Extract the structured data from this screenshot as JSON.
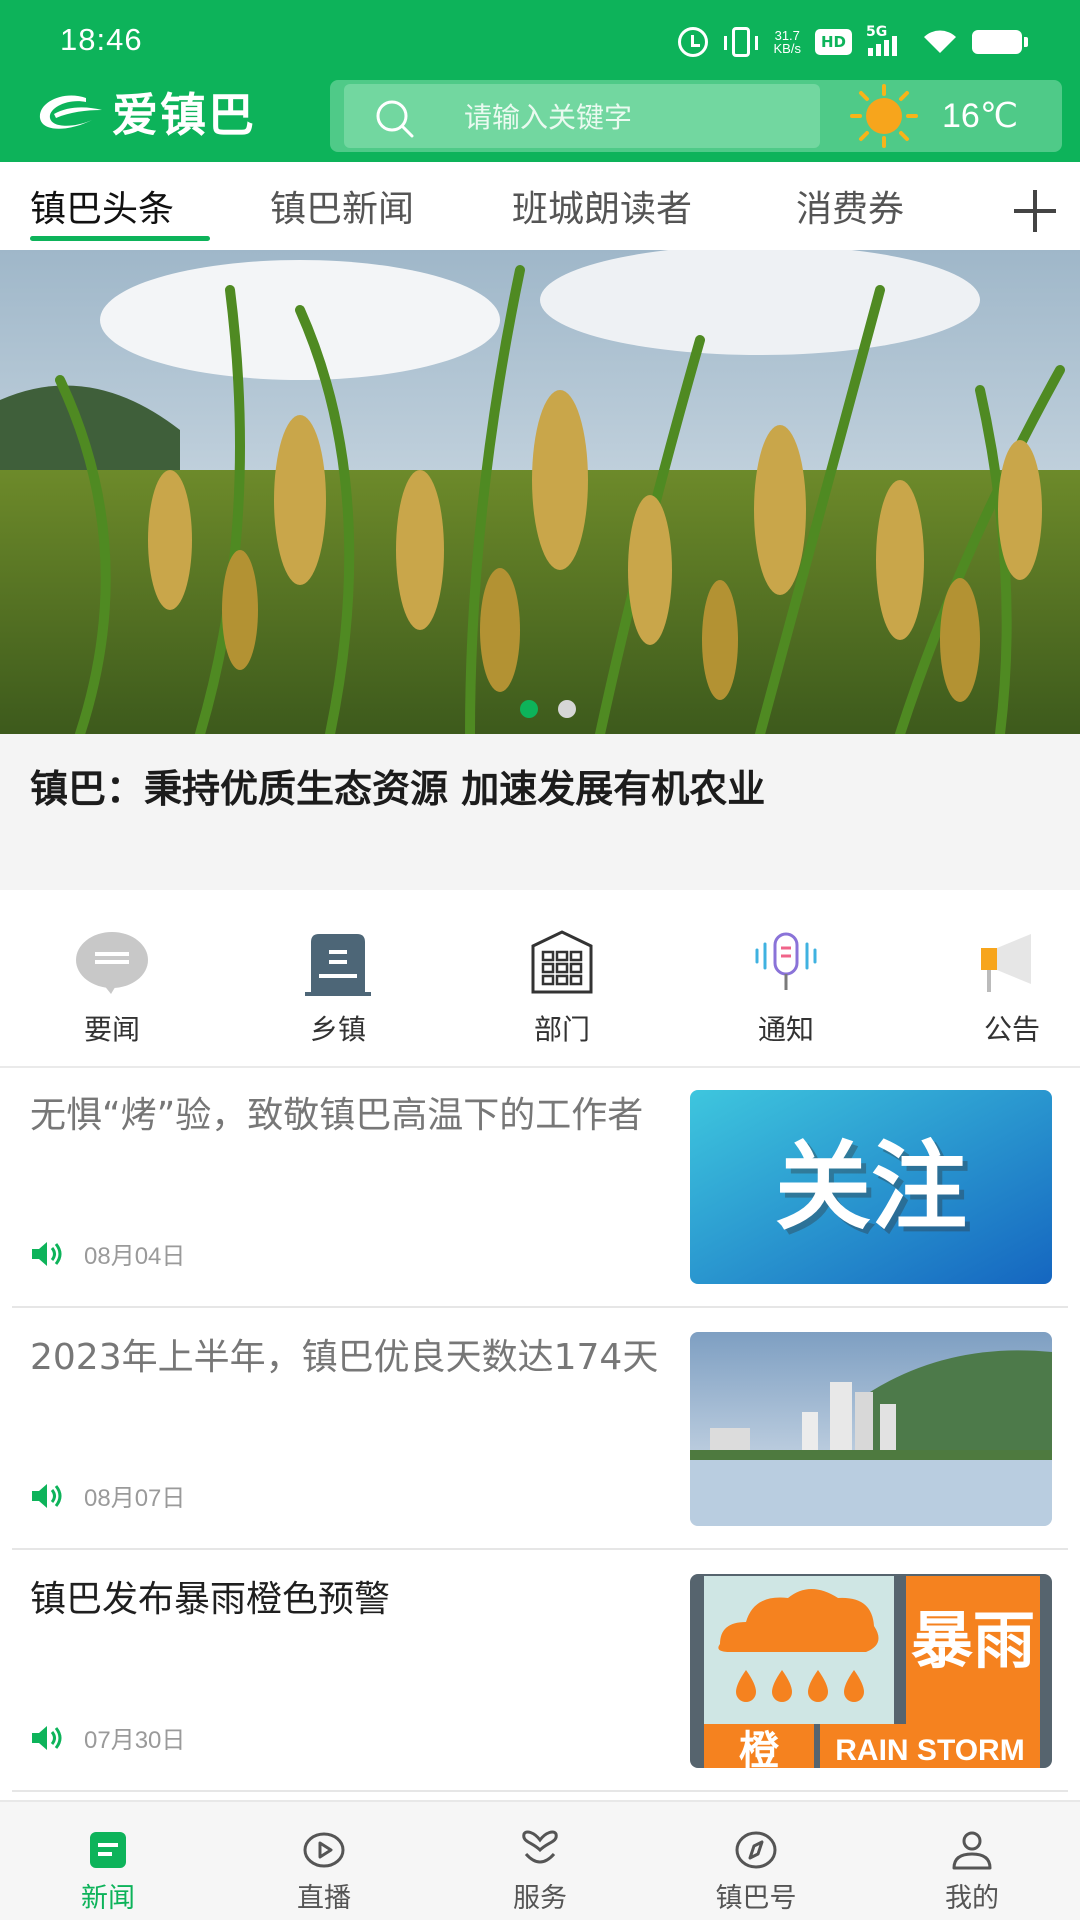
{
  "status_bar": {
    "time": "18:46",
    "network_speed_value": "31.7",
    "network_speed_unit": "KB/s",
    "hd_badge": "HD",
    "network_type": "5G"
  },
  "header": {
    "logo_text": "爱镇巴",
    "search_placeholder": "请输入关键字",
    "temperature": "16℃",
    "weather_icon": "sun-icon",
    "brand_color": "#0db35a"
  },
  "tabs": [
    {
      "label": "镇巴头条",
      "active": true
    },
    {
      "label": "镇巴新闻",
      "active": false
    },
    {
      "label": "班城朗读者",
      "active": false
    },
    {
      "label": "消费券",
      "active": false
    }
  ],
  "banner": {
    "headline": "镇巴：秉持优质生态资源 加速发展有机农业",
    "slide_count": 2,
    "active_slide": 1
  },
  "quick_links": [
    {
      "label": "要闻",
      "icon": "message-icon"
    },
    {
      "label": "乡镇",
      "icon": "building-icon"
    },
    {
      "label": "部门",
      "icon": "office-icon"
    },
    {
      "label": "通知",
      "icon": "microphone-icon"
    },
    {
      "label": "公告",
      "icon": "megaphone-icon"
    }
  ],
  "news": [
    {
      "title": "无惧“烤”验，致敬镇巴高温下的工作者",
      "date": "08月04日",
      "read": true,
      "thumb_text": "关注"
    },
    {
      "title": "2023年上半年，镇巴优良天数达174天",
      "date": "08月07日",
      "read": true,
      "thumb_text": ""
    },
    {
      "title": "镇巴发布暴雨橙色预警",
      "date": "07月30日",
      "read": false,
      "thumb_text": "暴雨",
      "thumb_text_left": "橙",
      "thumb_text_en": "RAIN STORM"
    }
  ],
  "bottom_nav": [
    {
      "label": "新闻",
      "icon": "news-icon",
      "active": true
    },
    {
      "label": "直播",
      "icon": "play-icon",
      "active": false
    },
    {
      "label": "服务",
      "icon": "service-icon",
      "active": false
    },
    {
      "label": "镇巴号",
      "icon": "compass-icon",
      "active": false
    },
    {
      "label": "我的",
      "icon": "person-icon",
      "active": false
    }
  ]
}
